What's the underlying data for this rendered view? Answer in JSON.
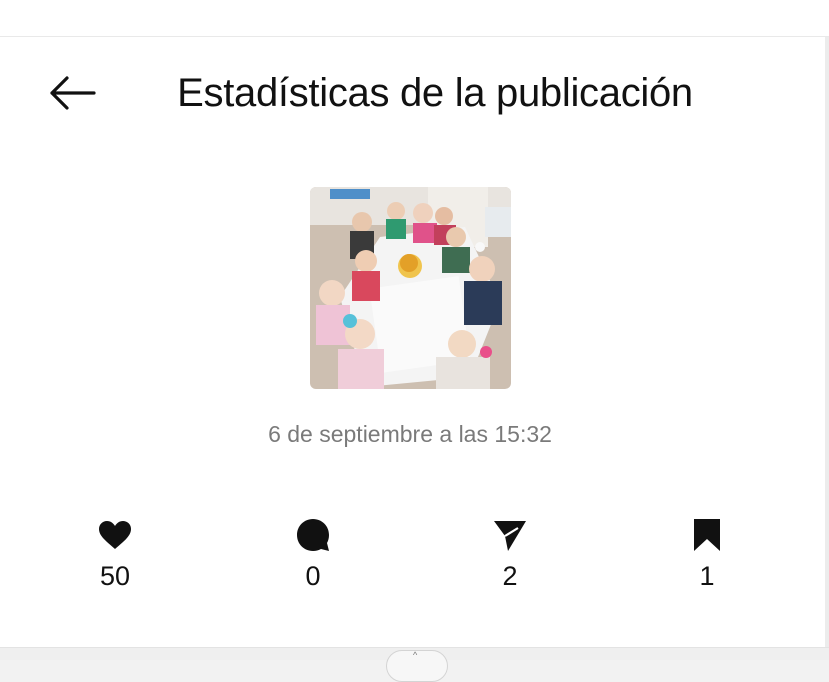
{
  "header": {
    "back_icon": "arrow-left-icon",
    "title": "Estadísticas de la publicación"
  },
  "post": {
    "thumbnail_icon": "post-photo-thumbnail",
    "date": "6 de septiembre a las 15:32"
  },
  "stats": [
    {
      "icon": "heart-icon",
      "count": "50"
    },
    {
      "icon": "comment-icon",
      "count": "0"
    },
    {
      "icon": "send-icon",
      "count": "2"
    },
    {
      "icon": "bookmark-icon",
      "count": "1"
    }
  ],
  "colors": {
    "text": "#111111",
    "muted": "#7a7a7a",
    "background": "#ffffff"
  }
}
